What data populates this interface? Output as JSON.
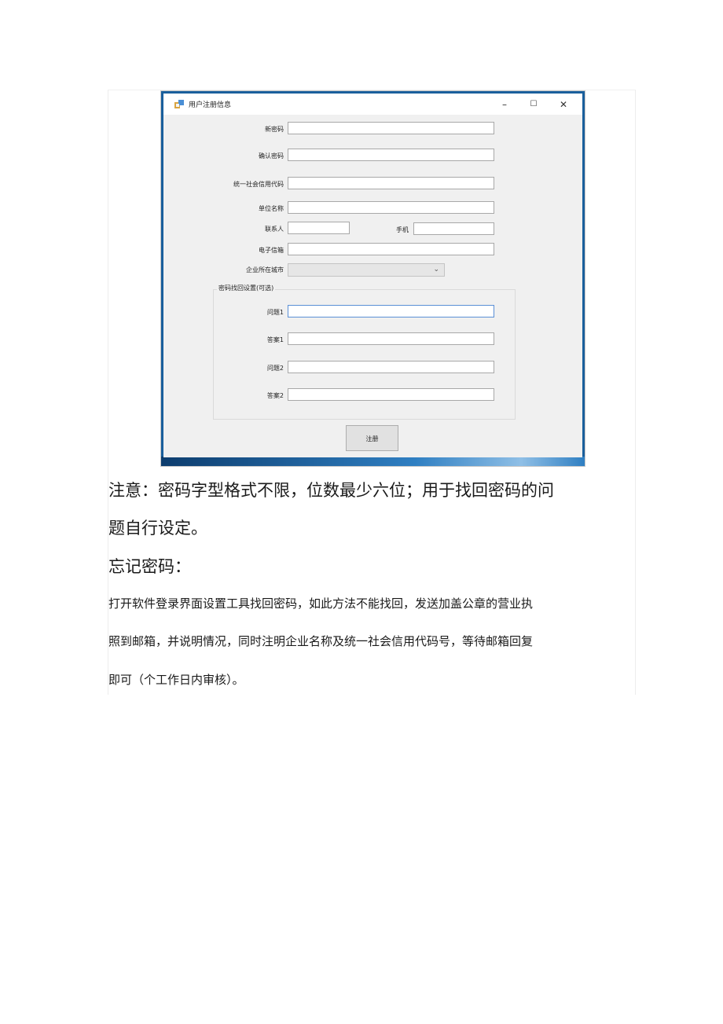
{
  "window": {
    "title": "用户注册信息",
    "minimize_glyph": "–",
    "maximize_glyph": "☐",
    "close_glyph": "✕",
    "icon": "app-icon"
  },
  "form": {
    "new_password_label": "新密码",
    "new_password_value": "",
    "confirm_password_label": "确认密码",
    "confirm_password_value": "",
    "credit_code_label": "统一社会信用代码",
    "credit_code_value": "",
    "company_name_label": "单位名称",
    "company_name_value": "",
    "contact_label": "联系人",
    "contact_value": "",
    "phone_label": "手机",
    "phone_value": "",
    "email_label": "电子信箱",
    "email_value": "",
    "city_label": "企业所在城市",
    "city_selected": "",
    "dropdown_glyph": "⌄"
  },
  "recovery": {
    "group_title": "密码找回设置(可选)",
    "question1_label": "问题1",
    "question1_value": "",
    "answer1_label": "答案1",
    "answer1_value": "",
    "question2_label": "问题2",
    "question2_value": "",
    "answer2_label": "答案2",
    "answer2_value": ""
  },
  "register_button_label": "注册",
  "document": {
    "note_line1": "注意：密码字型格式不限，位数最少六位；用于找回密码的问",
    "note_line2": "题自行设定。",
    "forgot_heading": "忘记密码：",
    "para_line1": "打开软件登录界面设置工具找回密码，如此方法不能找回，发送加盖公章的营业执",
    "para_line2": "照到邮箱，并说明情况，同时注明企业名称及统一社会信用代码号，等待邮箱回复",
    "para_line3": "即可（个工作日内审核）。"
  },
  "colors": {
    "desktop_blue": "#1a5f9c",
    "window_bg": "#f0f0f0",
    "focus_border": "#5a8fd6"
  }
}
